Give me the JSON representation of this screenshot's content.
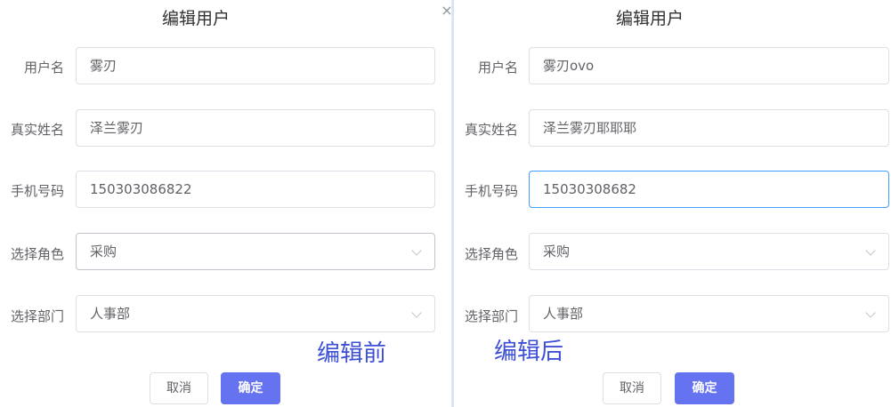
{
  "before": {
    "title": "编辑用户",
    "fields": {
      "username": {
        "label": "用户名",
        "value": "雾刃"
      },
      "realname": {
        "label": "真实姓名",
        "value": "泽兰雾刃"
      },
      "phone": {
        "label": "手机号码",
        "value": "150303086822"
      },
      "role": {
        "label": "选择角色",
        "value": "采购"
      },
      "department": {
        "label": "选择部门",
        "value": "人事部"
      }
    },
    "buttons": {
      "cancel": "取消",
      "confirm": "确定"
    },
    "annotation": "编辑前",
    "close_icon": "×"
  },
  "after": {
    "title": "编辑用户",
    "fields": {
      "username": {
        "label": "用户名",
        "value": "雾刃ovo"
      },
      "realname": {
        "label": "真实姓名",
        "value": "泽兰雾刃耶耶耶"
      },
      "phone": {
        "label": "手机号码",
        "value": "15030308682"
      },
      "role": {
        "label": "选择角色",
        "value": "采购"
      },
      "department": {
        "label": "选择部门",
        "value": "人事部"
      }
    },
    "buttons": {
      "cancel": "取消",
      "confirm": "确定"
    },
    "annotation": "编辑后"
  },
  "colors": {
    "primary_button": "#6573f0",
    "focus_border": "#409eff",
    "annotation_text": "#3d4fd6",
    "border": "#dcdfe6"
  }
}
